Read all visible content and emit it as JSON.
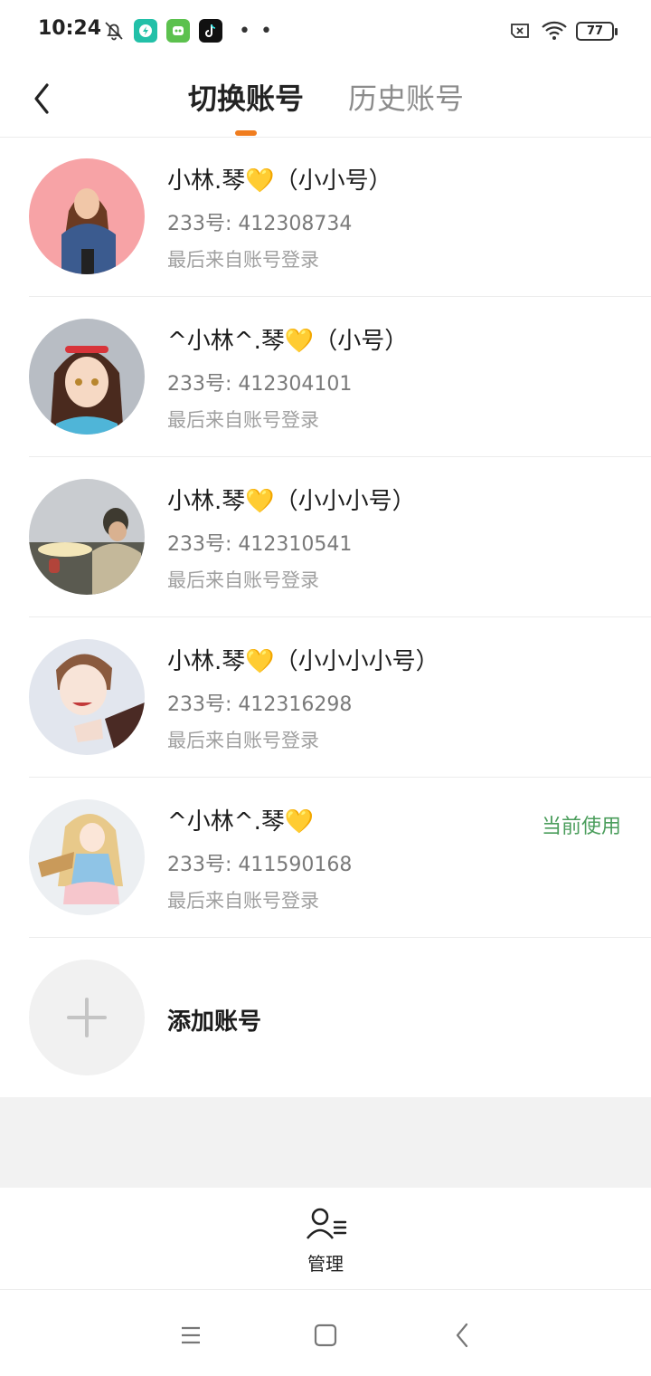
{
  "status_bar": {
    "time": "10:24",
    "icons": [
      "bell-off-icon",
      "app-shield-icon",
      "app-green-icon",
      "tiktok-icon",
      "more-dots-icon",
      "sim-off-icon",
      "wifi-icon"
    ],
    "dots": "• •",
    "battery": "77"
  },
  "header": {
    "back_icon": "back-arrow-icon",
    "tabs": [
      {
        "label": "切换账号",
        "active": true
      },
      {
        "label": "历史账号",
        "active": false
      }
    ],
    "accent_color": "#f07d1f"
  },
  "accounts": [
    {
      "name": "小林.琴💛（小小号）",
      "id": "233号: 412308734",
      "source": "最后来自账号登录",
      "current": false,
      "avatar_colors": [
        "#f7a3a6",
        "#3b5b8f"
      ]
    },
    {
      "name": "^小林^.琴💛（小号）",
      "id": "233号: 412304101",
      "source": "最后来自账号登录",
      "current": false,
      "avatar_colors": [
        "#b8bdc4",
        "#4a2a1e"
      ]
    },
    {
      "name": "小林.琴💛（小小小号）",
      "id": "233号: 412310541",
      "source": "最后来自账号登录",
      "current": false,
      "avatar_colors": [
        "#8a8c85",
        "#3e3a30"
      ]
    },
    {
      "name": "小林.琴💛（小小小小号）",
      "id": "233号: 412316298",
      "source": "最后来自账号登录",
      "current": false,
      "avatar_colors": [
        "#e2e6ee",
        "#8a5a3e"
      ]
    },
    {
      "name": "^小林^.琴💛",
      "id": "233号: 411590168",
      "source": "最后来自账号登录",
      "current": true,
      "avatar_colors": [
        "#eceff2",
        "#e8c98a"
      ]
    }
  ],
  "current_label": "当前使用",
  "current_color": "#4a9d5b",
  "add_account": {
    "label": "添加账号",
    "icon": "plus-icon"
  },
  "manage": {
    "label": "管理",
    "icon": "user-list-icon"
  },
  "nav_bar": {
    "icons": [
      "menu-icon",
      "home-square-icon",
      "back-chevron-icon"
    ]
  }
}
